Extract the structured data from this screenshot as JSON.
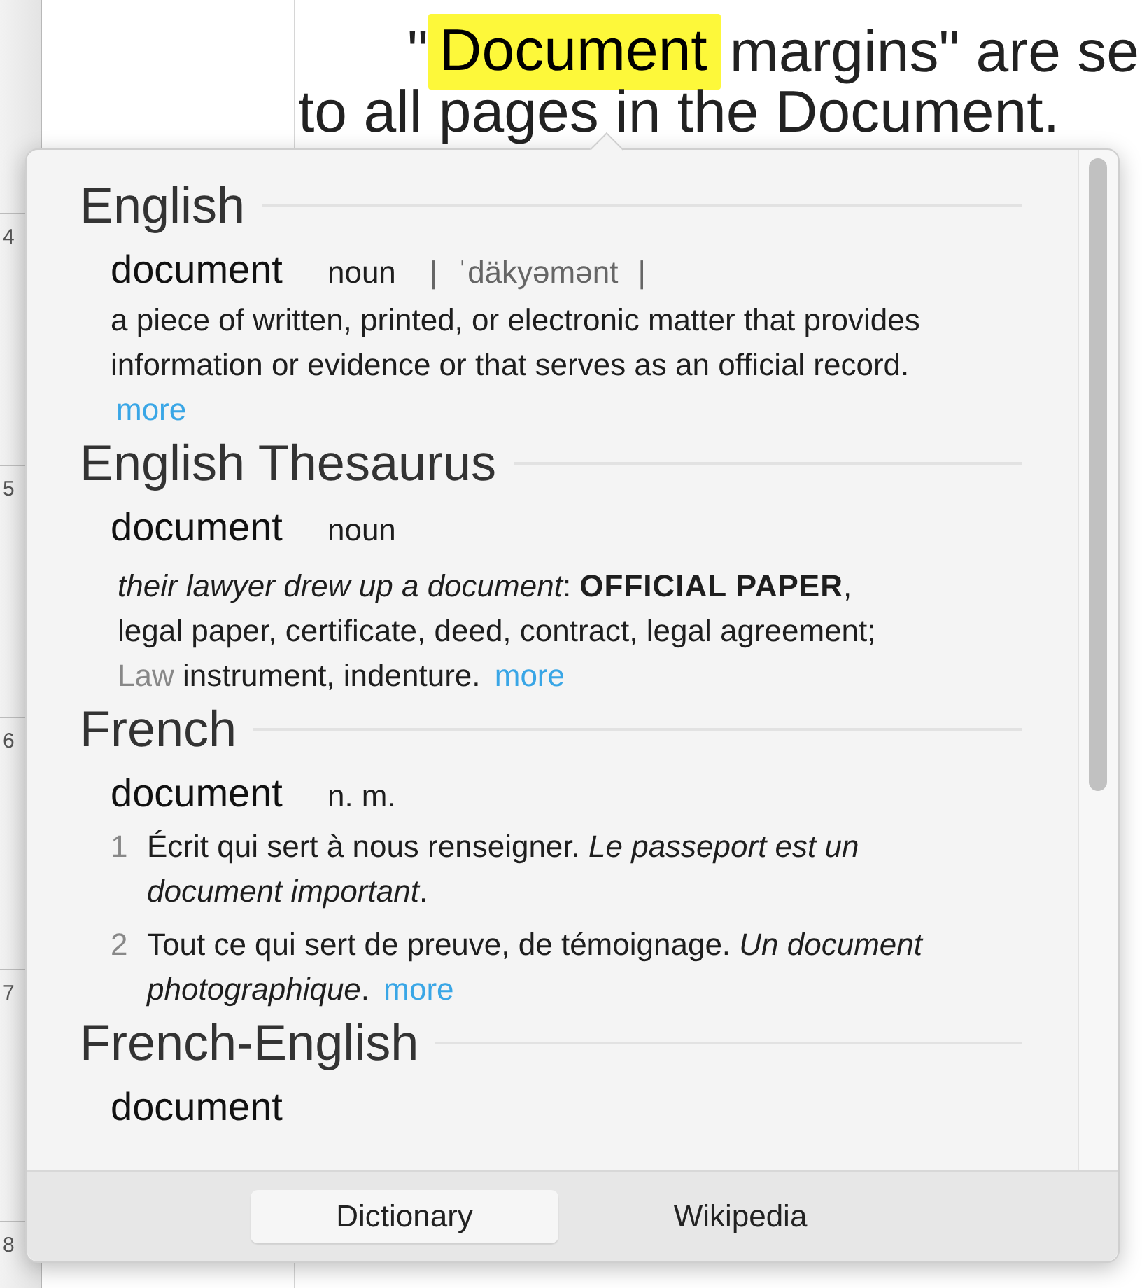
{
  "ruler": {
    "numbers": [
      "4",
      "5",
      "6",
      "7",
      "8"
    ]
  },
  "document": {
    "first_line": {
      "open_quote": "\"",
      "highlight": "Document",
      "rest": "margins\" are se"
    },
    "second_line": "to all pages in the Document."
  },
  "popover": {
    "sections": [
      {
        "kind": "definition",
        "heading": "English",
        "headword": "document",
        "pos": "noun",
        "pronunciation": "| ˈdäkyəmənt |",
        "definition": "a piece of written, printed, or electronic matter that provides information or evidence or that serves as an official record.",
        "more": "more"
      },
      {
        "kind": "thesaurus",
        "heading": "English Thesaurus",
        "headword": "document",
        "pos": "noun",
        "synonyms": "*their lawyer drew up a document*: **OFFICIAL PAPER**, legal paper, certificate, deed, contract, legal agreement;",
        "register": "Law",
        "register_synonyms": "instrument, indenture.",
        "more": "more"
      },
      {
        "kind": "numbered",
        "heading": "French",
        "headword": "document",
        "pos": "n. m.",
        "senses": [
          {
            "number": "1",
            "text": "Écrit qui sert à nous renseigner. *Le passeport est un document important*."
          },
          {
            "number": "2",
            "text": "Tout ce qui sert de preuve, de témoignage. *Un document photographique*."
          }
        ],
        "more": "more"
      },
      {
        "kind": "cut",
        "heading": "French-English",
        "headword": "document"
      }
    ],
    "tabs": [
      {
        "label": "Dictionary",
        "selected": true
      },
      {
        "label": "Wikipedia",
        "selected": false
      }
    ]
  }
}
